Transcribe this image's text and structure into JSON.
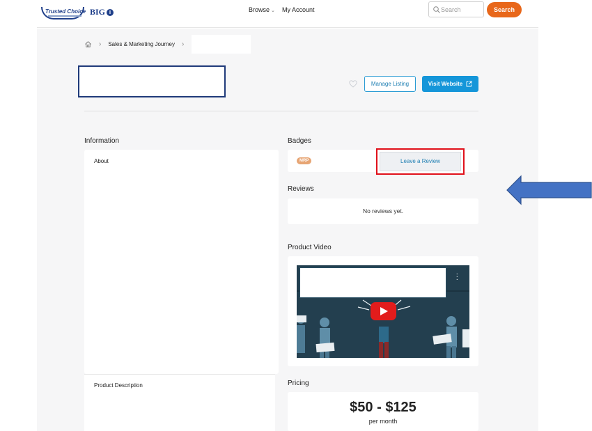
{
  "header": {
    "logo_trusted_choice": "Trusted Choice",
    "logo_big": "BIG",
    "logo_big_icon": "i",
    "nav_browse": "Browse",
    "nav_my_account": "My Account",
    "search_placeholder": "Search",
    "search_button": "Search"
  },
  "breadcrumb": {
    "items": [
      "Sales & Marketing Journey"
    ]
  },
  "actions": {
    "manage_listing": "Manage Listing",
    "visit_website": "Visit Website"
  },
  "information": {
    "heading": "Information",
    "about_label": "About",
    "product_description_label": "Product Description"
  },
  "badges": {
    "heading": "Badges",
    "items": [
      "MRP"
    ]
  },
  "reviews": {
    "heading": "Reviews",
    "leave_review": "Leave a Review",
    "empty_text": "No reviews yet."
  },
  "video": {
    "heading": "Product Video"
  },
  "pricing": {
    "heading": "Pricing",
    "price": "$50 - $125",
    "period": "per month"
  },
  "colors": {
    "accent_orange": "#e8671a",
    "primary_blue": "#1596d9",
    "highlight_red": "#e0101a",
    "arrow_blue": "#4472c4"
  }
}
